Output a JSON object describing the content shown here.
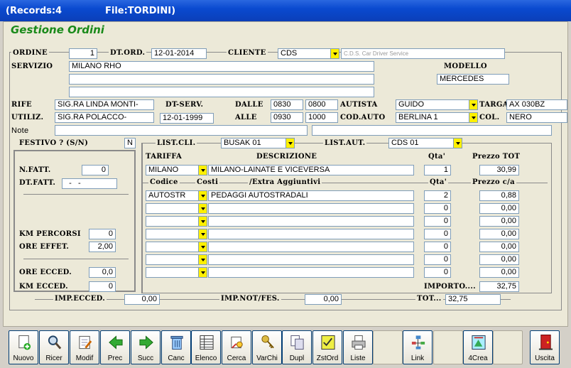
{
  "window": {
    "records": "(Records:4",
    "file": "File:TORDINI)"
  },
  "form_title": "Gestione Ordini",
  "labels": {
    "ordine": "ORDINE",
    "dt_ord": "DT.ORD.",
    "cliente": "CLIENTE",
    "servizio": "SERVIZIO",
    "modello": "MODELLO",
    "rife": "RIFE",
    "dt_serv": "DT-SERV.",
    "dalle": "DALLE",
    "autista": "AUTISTA",
    "targa": "TARGA",
    "utiliz": "UTILIZ.",
    "alle": "ALLE",
    "cod_auto": "COD.AUTO",
    "col": "COL.",
    "note": "Note",
    "festivo": "FESTIVO ? (S/N)",
    "list_cli": "LIST.CLI.",
    "list_aut": "LIST.AUT.",
    "tariffa": "TARIFFA",
    "descrizione": "DESCRIZIONE",
    "qta": "Qta'",
    "prezzo_tot": "Prezzo TOT",
    "codice": "Codice",
    "costi": "Costi",
    "extra": "/Extra Aggiuntivi",
    "qta2": "Qta'",
    "prezzo_ca": "Prezzo c/a",
    "n_fatt": "N.FATT.",
    "dt_fatt": "DT.FATT.",
    "km_percorsi": "KM PERCORSI",
    "ore_effet": "ORE EFFET.",
    "ore_ecced": "ORE ECCED.",
    "km_ecced": "KM  ECCED.",
    "importo": "IMPORTO....",
    "imp_ecced": "IMP.ECCED.",
    "imp_not": "IMP.NOT/FES.",
    "tot": "TOT..."
  },
  "values": {
    "ordine": "1",
    "dt_ord": "12-01-2014",
    "cliente_code": "CDS",
    "cliente_name": "C.D.S. Car Driver Service",
    "servizio1": "MILANO RHO",
    "servizio2": "",
    "servizio3": "",
    "modello": "MERCEDES",
    "rife": "SIG.RA LINDA MONTI-",
    "dalle1": "0830",
    "dalle2": "0800",
    "autista": "GUIDO",
    "targa": "AX 030BZ",
    "utiliz": "SIG.RA POLACCO-",
    "dt_serv": "12-01-1999",
    "alle1": "0930",
    "alle2": "1000",
    "cod_auto": "BERLINA 1",
    "col": "NERO",
    "note1": "",
    "note2": "",
    "festivo": "N",
    "list_cli": "BUSAK 01",
    "list_aut": "CDS   01",
    "tariffa": "MILANO",
    "descrizione": "MILANO-LAINATE E VICEVERSA",
    "qta": "1",
    "prezzo_tot": "30,99",
    "n_fatt": "0",
    "dt_fatt": "  -   -",
    "km_percorsi": "0",
    "ore_effet": "2,00",
    "ore_ecced": "0,0",
    "km_ecced": "0",
    "importo": "32,75",
    "imp_ecced": "0,00",
    "imp_not": "0,00",
    "tot": "32,75"
  },
  "extra_rows": [
    {
      "codice": "AUTOSTR",
      "descr": "PEDAGGI AUTOSTRADALI",
      "qta": "2",
      "prezzo": "0,88"
    },
    {
      "codice": "",
      "descr": "",
      "qta": "0",
      "prezzo": "0,00"
    },
    {
      "codice": "",
      "descr": "",
      "qta": "0",
      "prezzo": "0,00"
    },
    {
      "codice": "",
      "descr": "",
      "qta": "0",
      "prezzo": "0,00"
    },
    {
      "codice": "",
      "descr": "",
      "qta": "0",
      "prezzo": "0,00"
    },
    {
      "codice": "",
      "descr": "",
      "qta": "0",
      "prezzo": "0,00"
    },
    {
      "codice": "",
      "descr": "",
      "qta": "0",
      "prezzo": "0,00"
    }
  ],
  "toolbar": [
    {
      "label": "Nuovo",
      "icon": "new-icon"
    },
    {
      "label": "Ricer",
      "icon": "search-icon"
    },
    {
      "label": "Modif",
      "icon": "edit-icon"
    },
    {
      "label": "Prec",
      "icon": "arrow-left-icon"
    },
    {
      "label": "Succ",
      "icon": "arrow-right-icon"
    },
    {
      "label": "Canc",
      "icon": "trash-icon"
    },
    {
      "label": "Elenco",
      "icon": "list-icon"
    },
    {
      "label": "Cerca",
      "icon": "find-icon"
    },
    {
      "label": "VarChi",
      "icon": "keys-icon"
    },
    {
      "label": "Dupl",
      "icon": "duplicate-icon"
    },
    {
      "label": "ZstOrd",
      "icon": "sort-icon"
    },
    {
      "label": "Liste",
      "icon": "printer-icon"
    },
    {
      "label": "",
      "icon": ""
    },
    {
      "label": "Link",
      "icon": "link-icon"
    },
    {
      "label": "",
      "icon": ""
    },
    {
      "label": "4Crea",
      "icon": "create-icon"
    },
    {
      "label": "",
      "icon": ""
    },
    {
      "label": "Uscita",
      "icon": "exit-icon"
    }
  ],
  "colors": {
    "title_green": "#1a8a1a",
    "dropdown_yellow": "#fff000",
    "titlebar_blue": "#0a4ad0"
  }
}
